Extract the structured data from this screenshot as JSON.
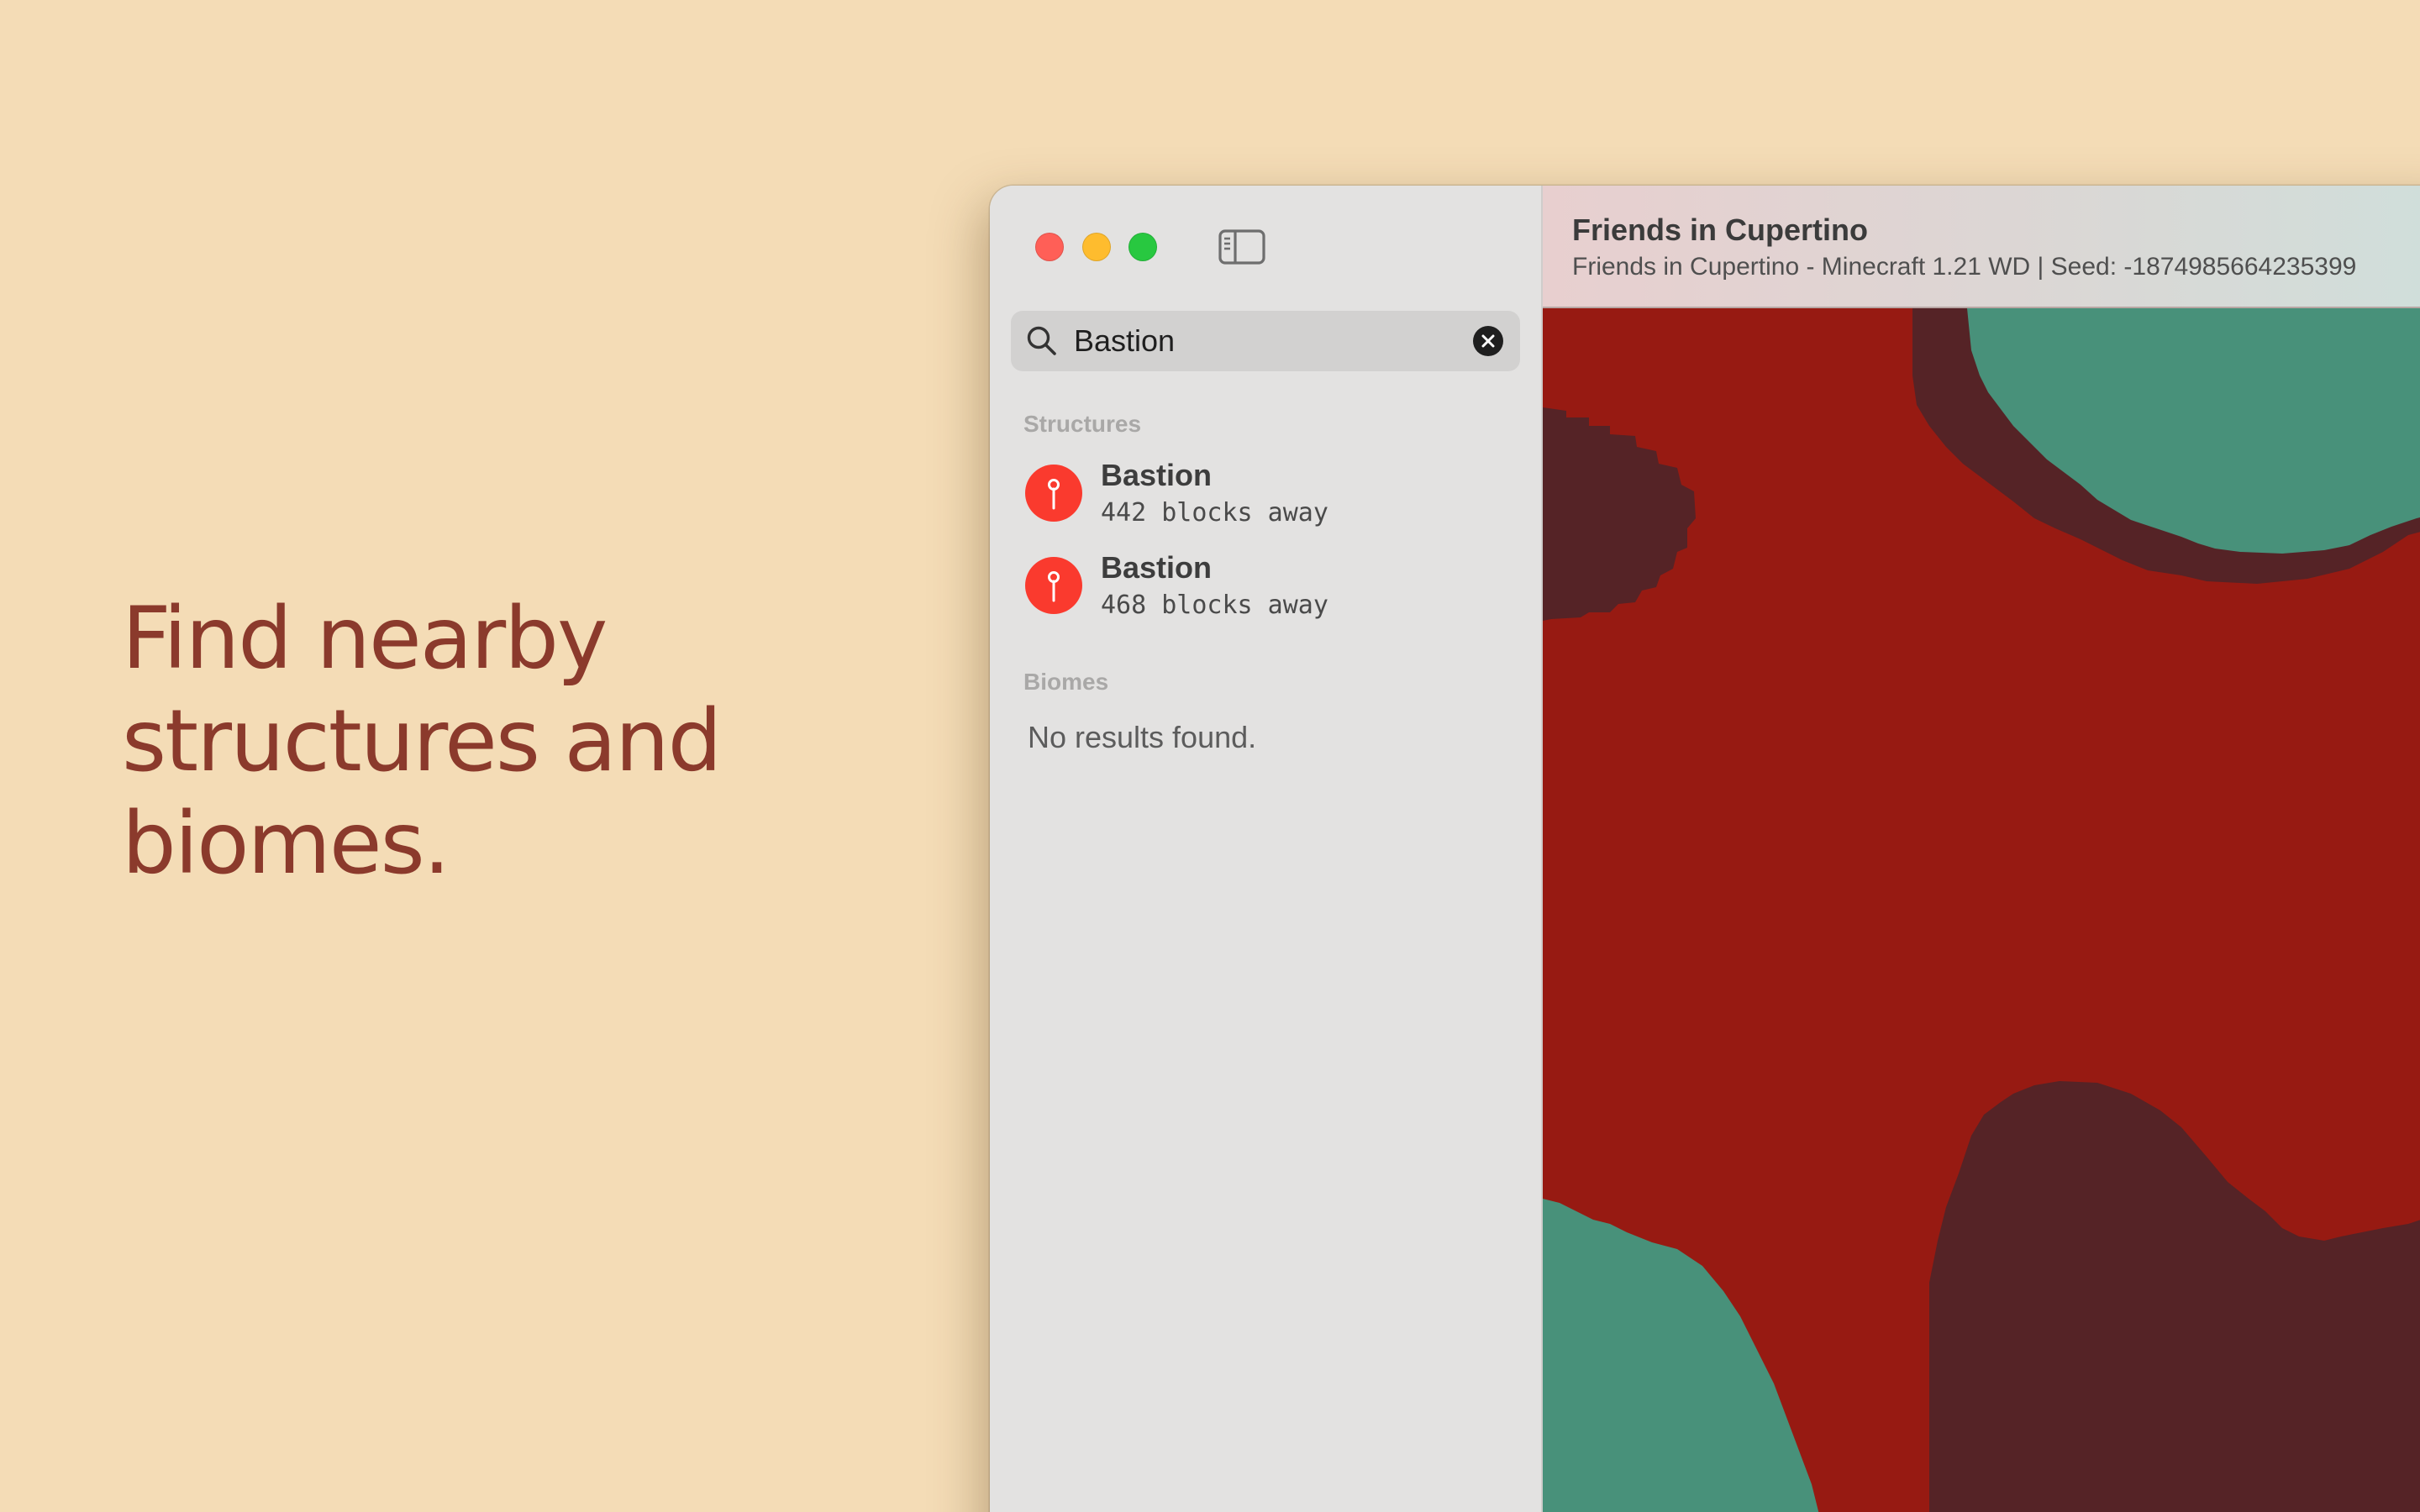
{
  "headline": {
    "lines": [
      "Find nearby",
      "structures and",
      "biomes."
    ],
    "color": "#8b3a2c"
  },
  "window": {
    "title": "Friends in Cupertino",
    "subtitle": "Friends in Cupertino - Minecraft 1.21 WD | Seed: -1874985664235399"
  },
  "search": {
    "value": "Bastion"
  },
  "sections": {
    "structures_label": "Structures",
    "biomes_label": "Biomes"
  },
  "structures": [
    {
      "name": "Bastion",
      "distance": "442 blocks away"
    },
    {
      "name": "Bastion",
      "distance": "468 blocks away"
    }
  ],
  "biomes": {
    "empty_text": "No results found."
  },
  "colors": {
    "background": "#f4dcb6",
    "pin": "#fa3a2e",
    "map_nether_wastes": "#971a12",
    "map_crimson_forest": "#552326",
    "map_warped_forest": "#48917a"
  }
}
